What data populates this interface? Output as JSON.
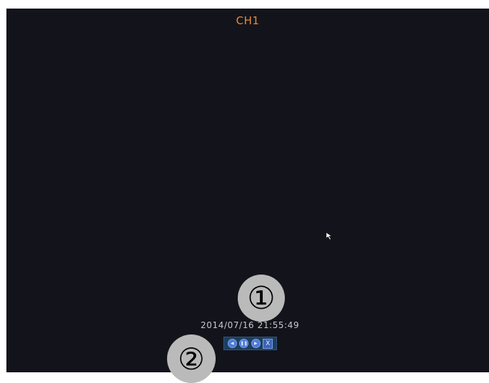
{
  "channel": {
    "title": "CH1"
  },
  "playback": {
    "timestamp": "2014/07/16 21:55:49",
    "controls": [
      {
        "name": "rewind-icon",
        "glyph": "◀"
      },
      {
        "name": "pause-icon",
        "glyph": "❚❚"
      },
      {
        "name": "play-icon",
        "glyph": "▶"
      },
      {
        "name": "close-icon",
        "glyph": "X"
      }
    ]
  },
  "callouts": {
    "one": "①",
    "two": "②"
  },
  "colors": {
    "background": "#13141b",
    "title": "#e98a32",
    "timestamp": "#c8c8cc",
    "control_bar": "#1e3d5c",
    "control_button": "#4f7bd6"
  }
}
